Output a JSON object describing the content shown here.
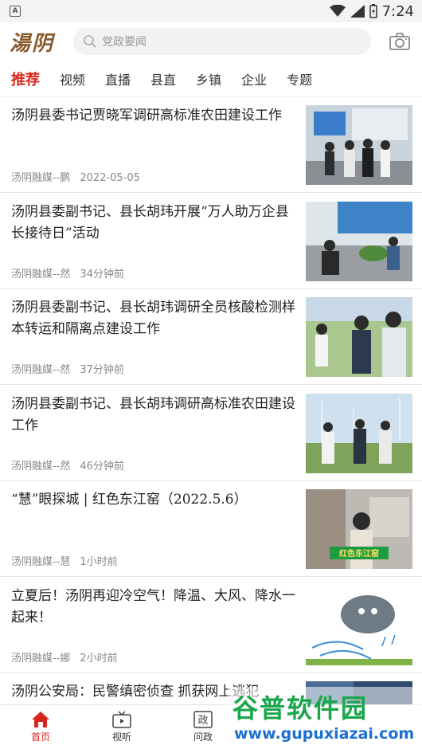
{
  "status": {
    "time": "7:24",
    "app_badge": "A"
  },
  "header": {
    "logo_text": "湯阴",
    "search_placeholder": "党政要闻"
  },
  "tabs": [
    {
      "label": "推荐",
      "active": true
    },
    {
      "label": "视频"
    },
    {
      "label": "直播"
    },
    {
      "label": "县直"
    },
    {
      "label": "乡镇"
    },
    {
      "label": "企业"
    },
    {
      "label": "专题"
    }
  ],
  "news": [
    {
      "title": "汤阴县委书记贾晓军调研高标准农田建设工作",
      "source": "汤阴融媒--鹏",
      "time": "2022-05-05"
    },
    {
      "title": "汤阴县委副书记、县长胡玮开展“万人助万企县长接待日”活动",
      "source": "汤阴融媒--然",
      "time": "34分钟前"
    },
    {
      "title": "汤阴县委副书记、县长胡玮调研全员核酸检测样本转运和隔离点建设工作",
      "source": "汤阴融媒--然",
      "time": "37分钟前"
    },
    {
      "title": "汤阴县委副书记、县长胡玮调研高标准农田建设工作",
      "source": "汤阴融媒--然",
      "time": "46分钟前"
    },
    {
      "title": "“慧”眼探城 | 红色东江窑（2022.5.6）",
      "source": "汤阴融媒--慧",
      "time": "1小时前",
      "thumb_caption": "红色东江窑"
    },
    {
      "title": "立夏后！汤阴再迎冷空气！降温、大风、降水一起来！",
      "source": "汤阴融媒--娜",
      "time": "2小时前"
    },
    {
      "title": "汤阴公安局：民警缜密侦查 抓获网上逃犯"
    }
  ],
  "bottom_nav": [
    {
      "label": "首页",
      "active": true
    },
    {
      "label": "视听"
    },
    {
      "label": "问政",
      "icon_text": "政"
    }
  ],
  "watermark": {
    "title": "谷普软件园",
    "url": "www.gupuxiazai.com"
  },
  "colors": {
    "accent": "#d9261c",
    "logo": "#8a5a2b"
  }
}
